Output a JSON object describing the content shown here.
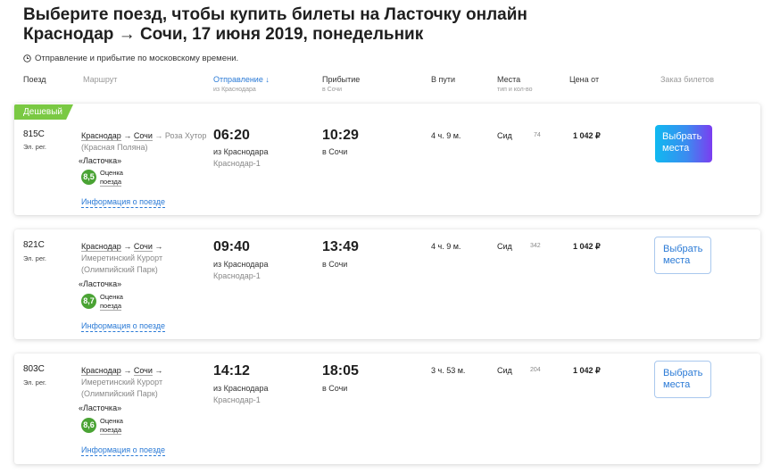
{
  "header": {
    "title_line1": "Выберите поезд, чтобы купить билеты на Ласточку онлайн",
    "title_line2": "Краснодар → Сочи, 17 июня 2019, понедельник",
    "timezone_note": "Отправление и прибытие по московскому времени."
  },
  "columns": {
    "train": "Поезд",
    "route": "Маршрут",
    "departure": "Отправление ↓",
    "departure_sub": "из Краснодара",
    "arrival": "Прибытие",
    "arrival_sub": "в Сочи",
    "duration": "В пути",
    "seats": "Места",
    "seats_sub": "тип и кол-во",
    "price": "Цена от",
    "order": "Заказ билетов"
  },
  "icons": {
    "timezone": "clock-icon"
  },
  "colors": {
    "accent": "#2a7ad6",
    "badge": "#7ac943",
    "score": "#4aa334"
  },
  "trains": [
    {
      "badge": "Дешевый",
      "number": "815С",
      "type": "Эл. рег.",
      "route_from": "Краснодар",
      "arrow": "→",
      "route_to": "Сочи",
      "route_extra_1": "→ Роза Хутор",
      "route_extra_2": "(Красная Поляна)",
      "name": "«Ласточка»",
      "score": "8,5",
      "score_label_1": "Оценка",
      "score_label_2": "поезда",
      "info_link": "Информация о поезде",
      "departure_time": "06:20",
      "departure_from": "из Краснодара",
      "departure_station": "Краснодар-1",
      "arrival_time": "10:29",
      "arrival_to": "в Сочи",
      "duration": "4 ч. 9 м.",
      "seat_type": "Сид",
      "seat_count": "74",
      "price": "1 042 ₽",
      "button_line1": "Выбрать",
      "button_line2": "места"
    },
    {
      "number": "821С",
      "type": "Эл. рег.",
      "route_from": "Краснодар",
      "arrow": "→",
      "route_to": "Сочи",
      "route_extra_1": "→",
      "route_extra_2": "Имеретинский Курорт",
      "route_extra_3": "(Олимпийский Парк)",
      "name": "«Ласточка»",
      "score": "8,7",
      "score_label_1": "Оценка",
      "score_label_2": "поезда",
      "info_link": "Информация о поезде",
      "departure_time": "09:40",
      "departure_from": "из Краснодара",
      "departure_station": "Краснодар-1",
      "arrival_time": "13:49",
      "arrival_to": "в Сочи",
      "duration": "4 ч. 9 м.",
      "seat_type": "Сид",
      "seat_count": "342",
      "price": "1 042 ₽",
      "button_line1": "Выбрать",
      "button_line2": "места"
    },
    {
      "number": "803С",
      "type": "Эл. рег.",
      "route_from": "Краснодар",
      "arrow": "→",
      "route_to": "Сочи",
      "route_extra_1": "→",
      "route_extra_2": "Имеретинский Курорт",
      "route_extra_3": "(Олимпийский Парк)",
      "name": "«Ласточка»",
      "score": "8,6",
      "score_label_1": "Оценка",
      "score_label_2": "поезда",
      "info_link": "Информация о поезде",
      "departure_time": "14:12",
      "departure_from": "из Краснодара",
      "departure_station": "Краснодар-1",
      "arrival_time": "18:05",
      "arrival_to": "в Сочи",
      "duration": "3 ч. 53 м.",
      "seat_type": "Сид",
      "seat_count": "204",
      "price": "1 042 ₽",
      "button_line1": "Выбрать",
      "button_line2": "места"
    }
  ]
}
